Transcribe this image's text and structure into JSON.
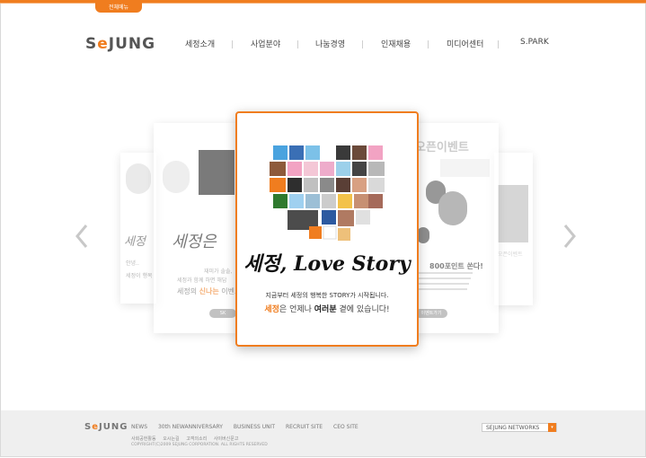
{
  "header": {
    "menu_tab": "전체메뉴",
    "logo_prefix": "S",
    "logo_o": "e",
    "logo_suffix": "JUNG",
    "nav": [
      "세정소개",
      "사업분야",
      "나눔경영",
      "인재채용",
      "미디어센터",
      "S.PARK"
    ]
  },
  "carousel": {
    "left_card1": {
      "script": "세정",
      "small1": "안녕..",
      "small2": "세정이 행복"
    },
    "left_card2": {
      "script": "세정은",
      "line1": "재미가 솔솔,",
      "line2": "세정과 함께 하면 해답",
      "line3_a": "세정의",
      "line3_b": "신나는",
      "line3_c": "이벤트",
      "button": "SK"
    },
    "main": {
      "script": "세정, Love Story",
      "tagline": "지금부터 세정의 행복한 STORY가 시작됩니다.",
      "slogan_a": "세정",
      "slogan_b": "은 언제나 ",
      "slogan_c": "여러분",
      "slogan_d": " 곁에 있습니다!"
    },
    "right_card1": {
      "title": "오픈이벤트",
      "headline": "800포인트 쏜다!",
      "button": "이벤트가기"
    },
    "right_card2": {
      "title": "오픈이벤트"
    }
  },
  "footer": {
    "logo_prefix": "S",
    "logo_o": "e",
    "logo_suffix": "JUNG",
    "links": [
      "NEWS",
      "30th NEWANNIVERSARY",
      "BUSINESS UNIT",
      "RECRUIT SITE",
      "CEO SITE"
    ],
    "sub_links": [
      "사회공헌활동",
      "오시는길",
      "고객의소리",
      "사이버신문고"
    ],
    "copyright": "COPYRIGHT(C)2009 SEJUNG CORPORATION. ALL RIGHTS RESERVED",
    "networks_label": "SEJUNG NETWORKS",
    "networks_arrow": "▾"
  },
  "colors": {
    "accent": "#f07d1f",
    "footer_bg": "#efefef"
  }
}
